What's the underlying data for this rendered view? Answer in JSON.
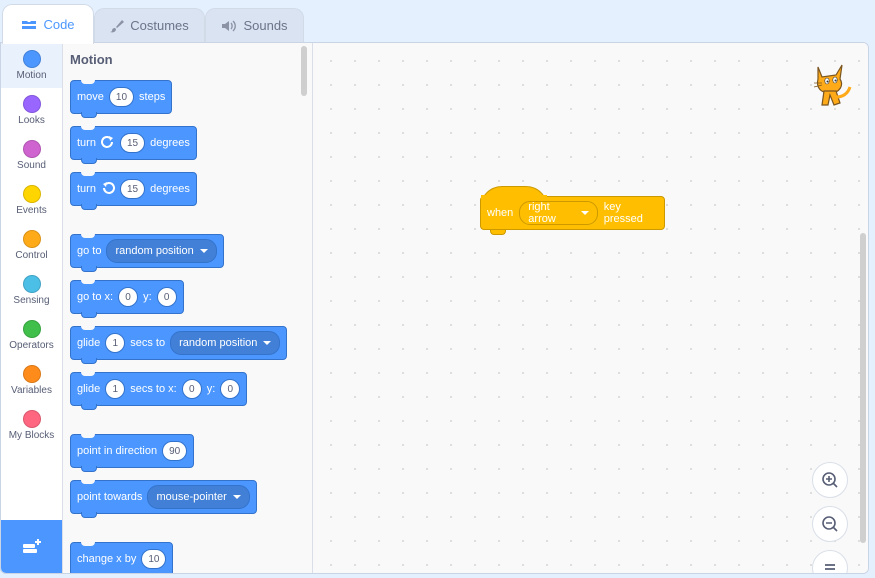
{
  "tabs": [
    {
      "label": "Code",
      "icon": "code-icon",
      "active": true
    },
    {
      "label": "Costumes",
      "icon": "brush-icon",
      "active": false
    },
    {
      "label": "Sounds",
      "icon": "speaker-icon",
      "active": false
    }
  ],
  "categories": [
    {
      "label": "Motion",
      "color": "#4c97ff"
    },
    {
      "label": "Looks",
      "color": "#9966ff"
    },
    {
      "label": "Sound",
      "color": "#cf63cf"
    },
    {
      "label": "Events",
      "color": "#ffd500"
    },
    {
      "label": "Control",
      "color": "#ffab19"
    },
    {
      "label": "Sensing",
      "color": "#4cbfe6"
    },
    {
      "label": "Operators",
      "color": "#40bf4a"
    },
    {
      "label": "Variables",
      "color": "#ff8c1a"
    },
    {
      "label": "My Blocks",
      "color": "#ff6680"
    }
  ],
  "palette": {
    "title": "Motion",
    "blocks": {
      "move": {
        "a": "move",
        "v": "10",
        "b": "steps"
      },
      "turn_right": {
        "a": "turn",
        "v": "15",
        "b": "degrees"
      },
      "turn_left": {
        "a": "turn",
        "v": "15",
        "b": "degrees"
      },
      "goto": {
        "a": "go to",
        "d": "random position"
      },
      "gotoxy": {
        "a": "go to x:",
        "x": "0",
        "yl": "y:",
        "y": "0"
      },
      "glide": {
        "a": "glide",
        "v": "1",
        "b": "secs to",
        "d": "random position"
      },
      "glidexy": {
        "a": "glide",
        "v": "1",
        "b": "secs to x:",
        "x": "0",
        "yl": "y:",
        "y": "0"
      },
      "point_dir": {
        "a": "point in direction",
        "v": "90"
      },
      "point_towards": {
        "a": "point towards",
        "d": "mouse-pointer"
      },
      "change_x": {
        "a": "change x by",
        "v": "10"
      }
    }
  },
  "workspace": {
    "hat": {
      "when": "when",
      "key": "right arrow",
      "tail": "key pressed"
    }
  }
}
